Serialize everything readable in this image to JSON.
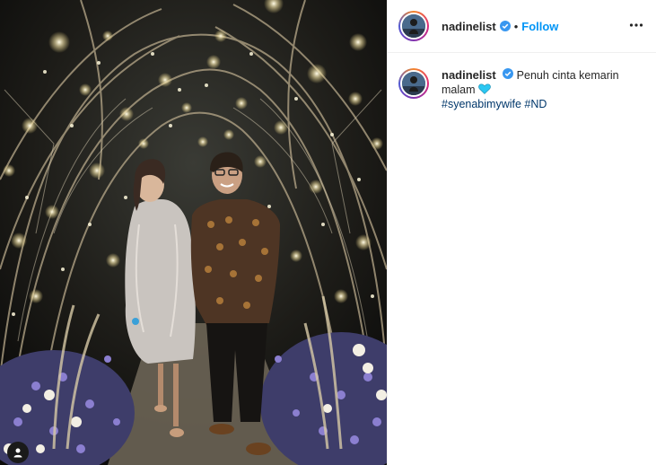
{
  "post": {
    "username": "nadinelist",
    "follow_label": "Follow",
    "separator": "•",
    "caption_line1": "Penuh cinta kemarin",
    "caption_line2": "malam",
    "caption_emoji": "blue-heart",
    "hashtag_1": "#syenabimywife",
    "hashtag_2": "#ND"
  },
  "icons": {
    "verified": "verified-badge-icon",
    "more": "more-options-icon",
    "tag": "user-tag-icon"
  },
  "colors": {
    "follow": "#0095f6",
    "verified": "#3897f0",
    "hashtag": "#00376b",
    "heart": "#2bc7f2"
  }
}
